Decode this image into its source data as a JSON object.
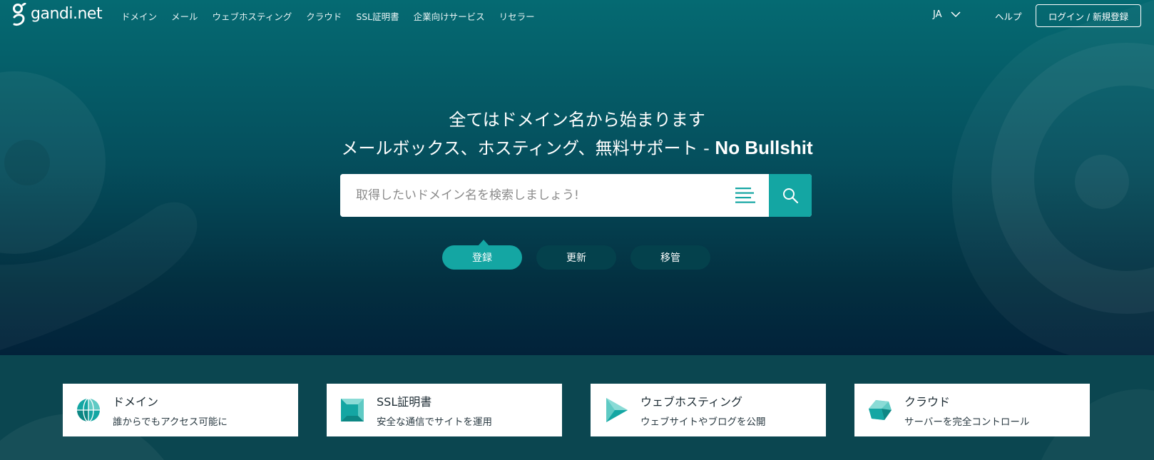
{
  "brand": {
    "logo_text": "gandi.net"
  },
  "nav": {
    "links": [
      "ドメイン",
      "メール",
      "ウェブホスティング",
      "クラウド",
      "SSL証明書",
      "企業向けサービス",
      "リセラー"
    ],
    "lang": "JA",
    "help": "ヘルプ",
    "login": "ログイン / 新規登録"
  },
  "hero": {
    "headline": "全てはドメイン名から始まります",
    "subline_prefix": "メールボックス、ホスティング、無料サポート - ",
    "subline_brand": "No Bullshit"
  },
  "search": {
    "placeholder": "取得したいドメイン名を検索しましょう!",
    "value": ""
  },
  "tabs": [
    {
      "label": "登録",
      "active": true
    },
    {
      "label": "更新",
      "active": false
    },
    {
      "label": "移管",
      "active": false
    }
  ],
  "cards": [
    {
      "icon": "globe-icon",
      "title": "ドメイン",
      "subtitle": "誰からでもアクセス可能に"
    },
    {
      "icon": "certificate-icon",
      "title": "SSL証明書",
      "subtitle": "安全な通信でサイトを運用"
    },
    {
      "icon": "play-arrow-icon",
      "title": "ウェブホスティング",
      "subtitle": "ウェブサイトやブログを公開"
    },
    {
      "icon": "cube-icon",
      "title": "クラウド",
      "subtitle": "サーバーを完全コントロール"
    }
  ],
  "colors": {
    "accent": "#14a6a3",
    "hero_top": "#056a72",
    "hero_bottom": "#02223a",
    "footer_band": "#0b4650"
  }
}
